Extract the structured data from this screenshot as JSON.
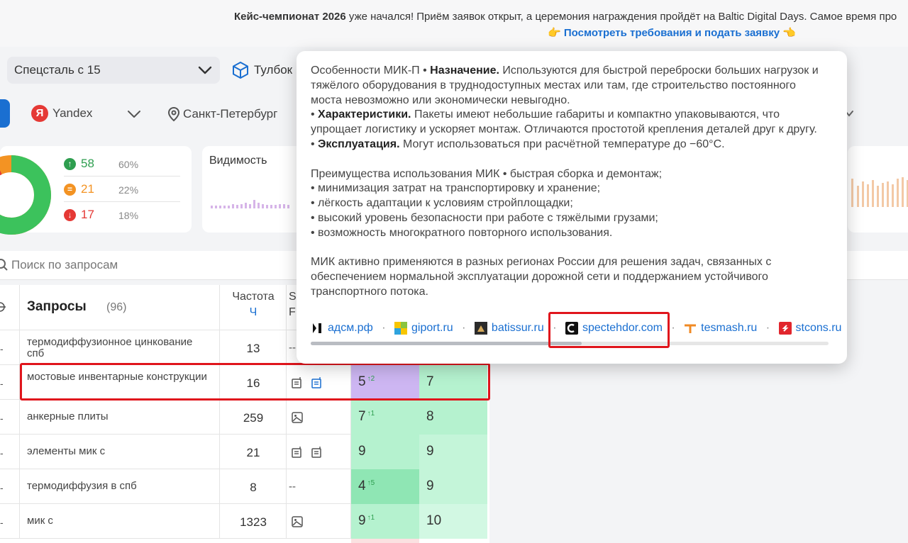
{
  "banner": {
    "text_bold": "Кейс-чемпионат 2026",
    "text_rest": " уже начался! Приём заявок открыт, а церемония награждения пройдёт на Baltic Digital Days. Самое время про",
    "link_prefix": "👉 ",
    "link_text": "Посмотреть требования и подать заявку",
    "link_suffix": " 👈"
  },
  "toolbar": {
    "project": "Спецсталь с 15",
    "tool_label": "Тулбок"
  },
  "filters": {
    "engine_logo": "Я",
    "engine": "Yandex",
    "city": "Санкт-Петербург"
  },
  "positions_card": {
    "up": {
      "count": "58",
      "pct": "60%"
    },
    "same": {
      "count": "21",
      "pct": "22%"
    },
    "down": {
      "count": "17",
      "pct": "18%"
    }
  },
  "visibility_card": {
    "title": "Видимость"
  },
  "search": {
    "placeholder": "Поиск по запросам"
  },
  "table": {
    "header": {
      "title": "Запросы",
      "count": "(96)",
      "freq_label": "Частота",
      "freq_sub": "Ч",
      "col_s_1": "S",
      "col_s_2": "F"
    },
    "rows": [
      {
        "query": "термодиффузионное цинкование спб",
        "freq": "13",
        "features": "--",
        "pos_a": "",
        "delta_a": "",
        "pos_b": ""
      },
      {
        "query": "мостовые инвентарные конструкции",
        "freq": "16",
        "features": "",
        "pos_a": "5",
        "delta_a": "↑2",
        "pos_b": "7"
      },
      {
        "query": "анкерные плиты",
        "freq": "259",
        "features": "",
        "pos_a": "7",
        "delta_a": "↑1",
        "pos_b": "8"
      },
      {
        "query": "элементы мик с",
        "freq": "21",
        "features": "",
        "pos_a": "9",
        "delta_a": "",
        "pos_b": "9"
      },
      {
        "query": "термодиффузия в спб",
        "freq": "8",
        "features": "--",
        "pos_a": "4",
        "delta_a": "↑5",
        "pos_b": "9"
      },
      {
        "query": "мик с",
        "freq": "1323",
        "features": "",
        "pos_a": "9",
        "delta_a": "↑1",
        "pos_b": "10"
      }
    ]
  },
  "popover": {
    "p1_lead": "Особенности МИК-П • ",
    "p1_bold": "Назначение.",
    "p1_rest": " Используются для быстрой переброски больших нагрузок и тяжёлого оборудования в труднодоступных местах или там, где строительство постоянного моста невозможно или экономически невыгодно.",
    "p2_bullet": "• ",
    "p2_bold": "Характеристики.",
    "p2_rest": " Пакеты имеют небольшие габариты и компактно упаковываются, что упрощает логистику и ускоряет монтаж. Отличаются простотой крепления деталей друг к другу.",
    "p3_bullet": "• ",
    "p3_bold": "Эксплуатация.",
    "p3_rest": " Могут использоваться при расчётной температуре до −60°C.",
    "adv_1": "Преимущества использования МИК • быстрая сборка и демонтаж;",
    "adv_2": "• минимизация затрат на транспортировку и хранение;",
    "adv_3": "• лёгкость адаптации к условиям стройплощадки;",
    "adv_4": "• высокий уровень безопасности при работе с тяжёлыми грузами;",
    "adv_5": "• возможность многократного повторного использования.",
    "final": "МИК активно применяются в разных регионах России для решения задач, связанных с обеспечением нормальной эксплуатации дорожной сети и поддержанием устойчивого транспортного потока.",
    "sources": [
      "адсм.рф",
      "giport.ru",
      "batissur.ru",
      "spectehdor.com",
      "tesmash.ru",
      "stcons.ru"
    ],
    "separator": "·"
  },
  "colors": {
    "accent": "#1a6fd1",
    "highlight_red": "#e0151c",
    "green_cell": "#b5f2cf",
    "green_cell_light": "#d2f8e3",
    "up_green": "#2e9e4f",
    "same_orange": "#f39323",
    "down_red": "#e53935"
  }
}
